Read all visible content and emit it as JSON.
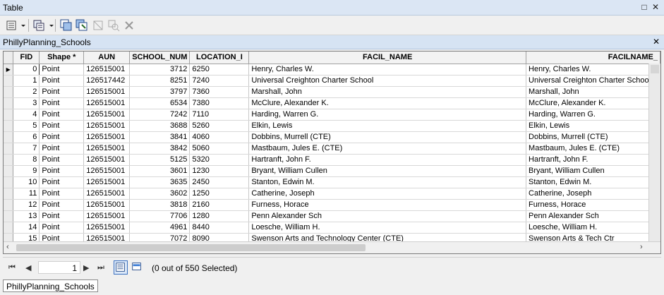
{
  "window": {
    "title": "Table"
  },
  "tab": {
    "title": "PhillyPlanning_Schools"
  },
  "toolbar": {
    "icons": [
      "table-options-icon",
      "dropdown-arrow-icon",
      "related-tables-icon",
      "dropdown-arrow-icon",
      "select-by-attributes-icon",
      "switch-selection-icon",
      "clear-selection-icon",
      "zoom-to-selected-icon",
      "delete-selected-icon"
    ]
  },
  "table": {
    "columns": [
      "FID",
      "Shape *",
      "AUN",
      "SCHOOL_NUM",
      "LOCATION_I",
      "FACIL_NAME",
      "FACILNAME_"
    ],
    "rows": [
      [
        "0",
        "Point",
        "126515001",
        "3712",
        "6250",
        "Henry, Charles W.",
        "Henry, Charles W."
      ],
      [
        "1",
        "Point",
        "126517442",
        "8251",
        "7240",
        "Universal Creighton Charter School",
        "Universal Creighton Charter School"
      ],
      [
        "2",
        "Point",
        "126515001",
        "3797",
        "7360",
        "Marshall, John",
        "Marshall, John"
      ],
      [
        "3",
        "Point",
        "126515001",
        "6534",
        "7380",
        "McClure, Alexander K.",
        "McClure, Alexander K."
      ],
      [
        "4",
        "Point",
        "126515001",
        "7242",
        "7110",
        "Harding, Warren G.",
        "Harding, Warren G."
      ],
      [
        "5",
        "Point",
        "126515001",
        "3688",
        "5260",
        "Elkin, Lewis",
        "Elkin, Lewis"
      ],
      [
        "6",
        "Point",
        "126515001",
        "3841",
        "4060",
        "Dobbins, Murrell (CTE)",
        "Dobbins, Murrell (CTE)"
      ],
      [
        "7",
        "Point",
        "126515001",
        "3842",
        "5060",
        "Mastbaum, Jules E. (CTE)",
        "Mastbaum, Jules E. (CTE)"
      ],
      [
        "8",
        "Point",
        "126515001",
        "5125",
        "5320",
        "Hartranft, John F.",
        "Hartranft, John F."
      ],
      [
        "9",
        "Point",
        "126515001",
        "3601",
        "1230",
        "Bryant, William Cullen",
        "Bryant, William Cullen"
      ],
      [
        "10",
        "Point",
        "126515001",
        "3635",
        "2450",
        "Stanton, Edwin M.",
        "Stanton, Edwin M."
      ],
      [
        "11",
        "Point",
        "126515001",
        "3602",
        "1250",
        "Catherine, Joseph",
        "Catherine, Joseph"
      ],
      [
        "12",
        "Point",
        "126515001",
        "3818",
        "2160",
        "Furness, Horace",
        "Furness, Horace"
      ],
      [
        "13",
        "Point",
        "126515001",
        "7706",
        "1280",
        "Penn Alexander Sch",
        "Penn Alexander Sch"
      ],
      [
        "14",
        "Point",
        "126515001",
        "4961",
        "8440",
        "Loesche, William H.",
        "Loesche, William H."
      ],
      [
        "15",
        "Point",
        "126515001",
        "7072",
        "8090",
        "Swenson Arts and Technology Center (CTE)",
        "Swenson Arts & Tech Ctr"
      ]
    ]
  },
  "navigation": {
    "current_record": "1",
    "status": "(0 out of 550 Selected)"
  },
  "bottom_tab": {
    "label": "PhillyPlanning_Schools"
  }
}
